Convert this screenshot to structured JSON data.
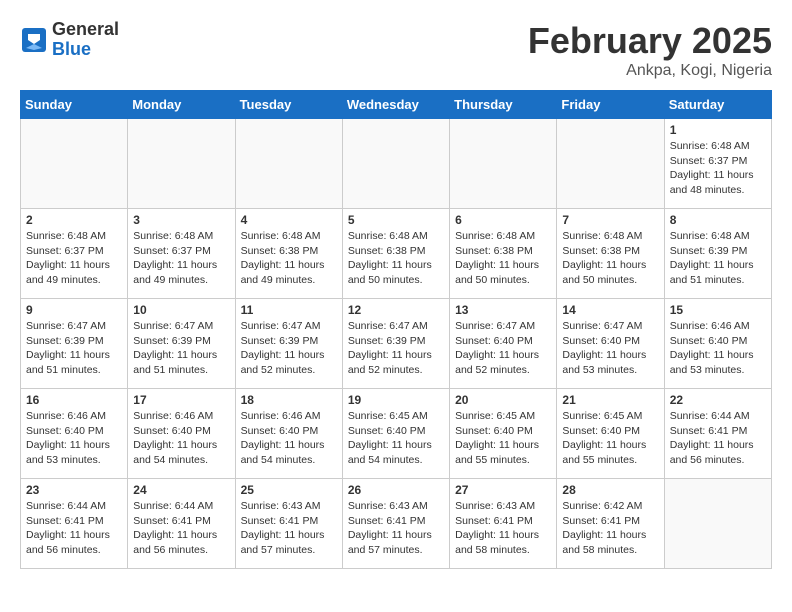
{
  "header": {
    "logo_general": "General",
    "logo_blue": "Blue",
    "month_title": "February 2025",
    "subtitle": "Ankpa, Kogi, Nigeria"
  },
  "weekdays": [
    "Sunday",
    "Monday",
    "Tuesday",
    "Wednesday",
    "Thursday",
    "Friday",
    "Saturday"
  ],
  "weeks": [
    [
      {
        "day": "",
        "info": ""
      },
      {
        "day": "",
        "info": ""
      },
      {
        "day": "",
        "info": ""
      },
      {
        "day": "",
        "info": ""
      },
      {
        "day": "",
        "info": ""
      },
      {
        "day": "",
        "info": ""
      },
      {
        "day": "1",
        "info": "Sunrise: 6:48 AM\nSunset: 6:37 PM\nDaylight: 11 hours and 48 minutes."
      }
    ],
    [
      {
        "day": "2",
        "info": "Sunrise: 6:48 AM\nSunset: 6:37 PM\nDaylight: 11 hours and 49 minutes."
      },
      {
        "day": "3",
        "info": "Sunrise: 6:48 AM\nSunset: 6:37 PM\nDaylight: 11 hours and 49 minutes."
      },
      {
        "day": "4",
        "info": "Sunrise: 6:48 AM\nSunset: 6:38 PM\nDaylight: 11 hours and 49 minutes."
      },
      {
        "day": "5",
        "info": "Sunrise: 6:48 AM\nSunset: 6:38 PM\nDaylight: 11 hours and 50 minutes."
      },
      {
        "day": "6",
        "info": "Sunrise: 6:48 AM\nSunset: 6:38 PM\nDaylight: 11 hours and 50 minutes."
      },
      {
        "day": "7",
        "info": "Sunrise: 6:48 AM\nSunset: 6:38 PM\nDaylight: 11 hours and 50 minutes."
      },
      {
        "day": "8",
        "info": "Sunrise: 6:48 AM\nSunset: 6:39 PM\nDaylight: 11 hours and 51 minutes."
      }
    ],
    [
      {
        "day": "9",
        "info": "Sunrise: 6:47 AM\nSunset: 6:39 PM\nDaylight: 11 hours and 51 minutes."
      },
      {
        "day": "10",
        "info": "Sunrise: 6:47 AM\nSunset: 6:39 PM\nDaylight: 11 hours and 51 minutes."
      },
      {
        "day": "11",
        "info": "Sunrise: 6:47 AM\nSunset: 6:39 PM\nDaylight: 11 hours and 52 minutes."
      },
      {
        "day": "12",
        "info": "Sunrise: 6:47 AM\nSunset: 6:39 PM\nDaylight: 11 hours and 52 minutes."
      },
      {
        "day": "13",
        "info": "Sunrise: 6:47 AM\nSunset: 6:40 PM\nDaylight: 11 hours and 52 minutes."
      },
      {
        "day": "14",
        "info": "Sunrise: 6:47 AM\nSunset: 6:40 PM\nDaylight: 11 hours and 53 minutes."
      },
      {
        "day": "15",
        "info": "Sunrise: 6:46 AM\nSunset: 6:40 PM\nDaylight: 11 hours and 53 minutes."
      }
    ],
    [
      {
        "day": "16",
        "info": "Sunrise: 6:46 AM\nSunset: 6:40 PM\nDaylight: 11 hours and 53 minutes."
      },
      {
        "day": "17",
        "info": "Sunrise: 6:46 AM\nSunset: 6:40 PM\nDaylight: 11 hours and 54 minutes."
      },
      {
        "day": "18",
        "info": "Sunrise: 6:46 AM\nSunset: 6:40 PM\nDaylight: 11 hours and 54 minutes."
      },
      {
        "day": "19",
        "info": "Sunrise: 6:45 AM\nSunset: 6:40 PM\nDaylight: 11 hours and 54 minutes."
      },
      {
        "day": "20",
        "info": "Sunrise: 6:45 AM\nSunset: 6:40 PM\nDaylight: 11 hours and 55 minutes."
      },
      {
        "day": "21",
        "info": "Sunrise: 6:45 AM\nSunset: 6:40 PM\nDaylight: 11 hours and 55 minutes."
      },
      {
        "day": "22",
        "info": "Sunrise: 6:44 AM\nSunset: 6:41 PM\nDaylight: 11 hours and 56 minutes."
      }
    ],
    [
      {
        "day": "23",
        "info": "Sunrise: 6:44 AM\nSunset: 6:41 PM\nDaylight: 11 hours and 56 minutes."
      },
      {
        "day": "24",
        "info": "Sunrise: 6:44 AM\nSunset: 6:41 PM\nDaylight: 11 hours and 56 minutes."
      },
      {
        "day": "25",
        "info": "Sunrise: 6:43 AM\nSunset: 6:41 PM\nDaylight: 11 hours and 57 minutes."
      },
      {
        "day": "26",
        "info": "Sunrise: 6:43 AM\nSunset: 6:41 PM\nDaylight: 11 hours and 57 minutes."
      },
      {
        "day": "27",
        "info": "Sunrise: 6:43 AM\nSunset: 6:41 PM\nDaylight: 11 hours and 58 minutes."
      },
      {
        "day": "28",
        "info": "Sunrise: 6:42 AM\nSunset: 6:41 PM\nDaylight: 11 hours and 58 minutes."
      },
      {
        "day": "",
        "info": ""
      }
    ]
  ]
}
